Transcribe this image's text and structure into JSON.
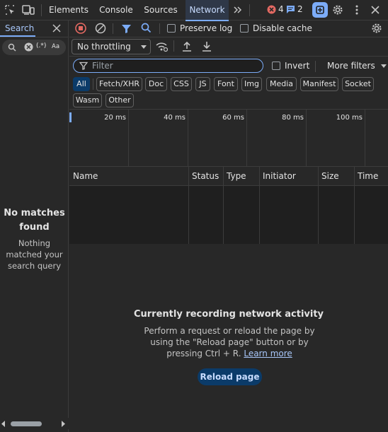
{
  "top_tabs": [
    {
      "label": "Elements"
    },
    {
      "label": "Console"
    },
    {
      "label": "Sources"
    },
    {
      "label": "Network"
    }
  ],
  "badges": {
    "errors": "4",
    "messages": "2"
  },
  "left_panel": {
    "tab_label": "Search",
    "regex_label": "(.*)",
    "case_label": "Aa",
    "no_match_title": "No matches found",
    "no_match_text": "Nothing matched your search query"
  },
  "toolbar": {
    "preserve_log": "Preserve log",
    "disable_cache": "Disable cache",
    "throttling": "No throttling"
  },
  "filter": {
    "placeholder": "Filter",
    "invert_label": "Invert",
    "more_filters": "More filters"
  },
  "type_chips": [
    {
      "label": "All",
      "active": true
    },
    {
      "label": "Fetch/XHR"
    },
    {
      "label": "Doc"
    },
    {
      "label": "CSS"
    },
    {
      "label": "JS"
    },
    {
      "label": "Font"
    },
    {
      "label": "Img"
    },
    {
      "label": "Media"
    },
    {
      "label": "Manifest"
    },
    {
      "label": "Socket"
    },
    {
      "label": "Wasm"
    },
    {
      "label": "Other"
    }
  ],
  "timeline_ticks": [
    "20 ms",
    "40 ms",
    "60 ms",
    "80 ms",
    "100 ms"
  ],
  "columns": [
    "Name",
    "Status",
    "Type",
    "Initiator",
    "Size",
    "Time"
  ],
  "empty_state": {
    "title": "Currently recording network activity",
    "text": "Perform a request or reload the page by using the \"Reload page\" button or by pressing Ctrl + R.",
    "link": "Learn more",
    "button": "Reload page"
  },
  "colors": {
    "accent": "#7cacf8",
    "error": "#e46962",
    "active_chip": "#0b3b69"
  }
}
